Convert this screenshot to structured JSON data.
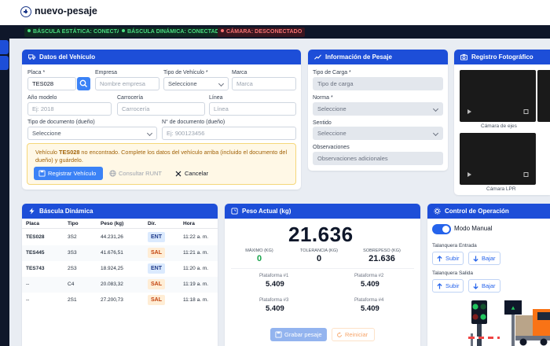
{
  "header": {
    "title": "nuevo-pesaje"
  },
  "status": [
    {
      "label": "BÁSCULA ESTÁTICA: CONECTADO",
      "state": "ok"
    },
    {
      "label": "BÁSCULA DINÁMICA: CONECTADO",
      "state": "ok"
    },
    {
      "label": "CÁMARA: DESCONECTADO",
      "state": "error"
    }
  ],
  "vehicle": {
    "title": "Datos del Vehículo",
    "placa_label": "Placa *",
    "placa_value": "TES028",
    "empresa_label": "Empresa",
    "empresa_placeholder": "Nombre empresa",
    "tipo_label": "Tipo de Vehículo *",
    "tipo_value": "Seleccione",
    "marca_label": "Marca",
    "marca_placeholder": "Marca",
    "anio_label": "Año modelo",
    "anio_placeholder": "Ej: 2018",
    "carroceria_label": "Carrocería",
    "carroceria_placeholder": "Carrocería",
    "linea_label": "Línea",
    "linea_placeholder": "Línea",
    "tipodoc_label": "Tipo de documento (dueño)",
    "tipodoc_value": "Seleccione",
    "numdoc_label": "N° de documento (dueño)",
    "numdoc_placeholder": "Ej: 900123456",
    "alert_prefix": "Vehículo ",
    "alert_plate": "TES028",
    "alert_suffix": " no encontrado. Complete los datos del vehículo arriba (incluido el documento del dueño) y guárdelo.",
    "btn_register": "Registrar Vehículo",
    "btn_runt": "Consultar RUNT",
    "btn_cancel": "Cancelar"
  },
  "weighing_info": {
    "title": "Información de Pesaje",
    "carga_label": "Tipo de Carga *",
    "carga_placeholder": "Tipo de carga",
    "norma_label": "Norma *",
    "norma_value": "Seleccione",
    "sentido_label": "Sentido",
    "sentido_value": "Seleccione",
    "obs_label": "Observaciones",
    "obs_placeholder": "Observaciones adicionales"
  },
  "photo": {
    "title": "Registro Fotográfico",
    "cam1": "Cámara de ejes",
    "cam2": "Cámara LPR"
  },
  "dynamic": {
    "title": "Báscula Dinámica",
    "columns": [
      "Placa",
      "Tipo",
      "Peso (kg)",
      "Dir.",
      "Hora"
    ],
    "rows": [
      {
        "placa": "TES028",
        "tipo": "3S2",
        "peso": "44.231,26",
        "dir": "ENT",
        "hora": "11:22 a. m."
      },
      {
        "placa": "TES445",
        "tipo": "3S3",
        "peso": "41.676,51",
        "dir": "SAL",
        "hora": "11:21 a. m."
      },
      {
        "placa": "TES743",
        "tipo": "2S3",
        "peso": "18.924,25",
        "dir": "ENT",
        "hora": "11:20 a. m."
      },
      {
        "placa": "--",
        "tipo": "C4",
        "peso": "20.083,32",
        "dir": "SAL",
        "hora": "11:19 a. m."
      },
      {
        "placa": "--",
        "tipo": "2S1",
        "peso": "27.200,73",
        "dir": "SAL",
        "hora": "11:18 a. m."
      }
    ]
  },
  "weight": {
    "title": "Peso Actual (kg)",
    "value": "21.636",
    "max_label": "MÁXIMO (KG)",
    "max_value": "0",
    "tol_label": "TOLERANCIA (KG)",
    "tol_value": "0",
    "over_label": "SOBREPESO (KG)",
    "over_value": "21.636",
    "platforms": [
      {
        "label": "Plataforma #1",
        "value": "5.409"
      },
      {
        "label": "Plataforma #2",
        "value": "5.409"
      },
      {
        "label": "Plataforma #3",
        "value": "5.409"
      },
      {
        "label": "Plataforma #4",
        "value": "5.409"
      }
    ],
    "btn_save": "Grabar pesaje",
    "btn_restart": "Reiniciar"
  },
  "control": {
    "title": "Control de Operación",
    "mode_label": "Modo Manual",
    "entrada_label": "Talanquera Entrada",
    "salida_label": "Talanquera Salida",
    "btn_up": "Subir",
    "btn_down": "Bajar"
  },
  "colors": {
    "primary": "#1d4ed8",
    "ok": "#4ade80",
    "error": "#f87171",
    "zero": "#16a34a",
    "overweight": "#111827"
  }
}
